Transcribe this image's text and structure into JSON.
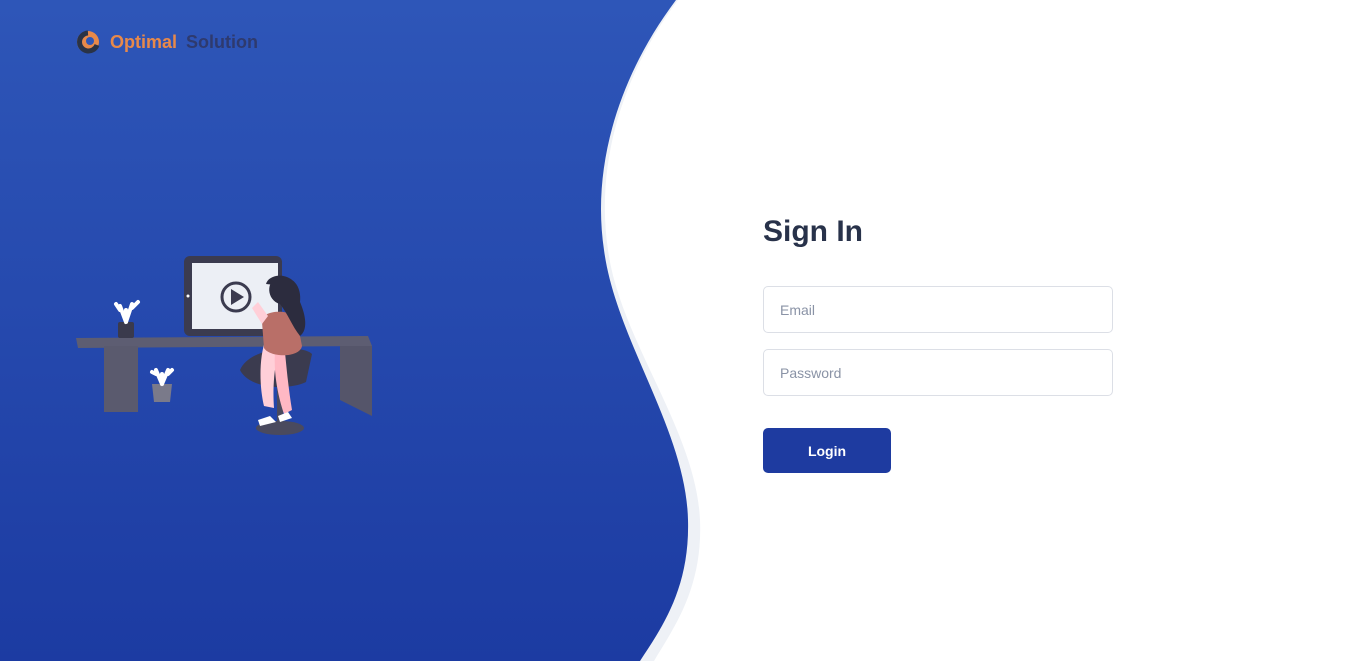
{
  "brand": {
    "word1": "Optimal",
    "word2": "Solution",
    "accent_color": "#e8894a",
    "dark_color": "#2e3a6e"
  },
  "background": {
    "panel_color_top": "#2e56b8",
    "panel_color_bottom": "#1c3ba2",
    "wave_shadow_color": "#eef1f6"
  },
  "illustration": {
    "icon": "play-icon"
  },
  "form": {
    "title": "Sign In",
    "email_placeholder": "Email",
    "password_placeholder": "Password",
    "login_label": "Login",
    "button_color": "#1e3ba0"
  }
}
